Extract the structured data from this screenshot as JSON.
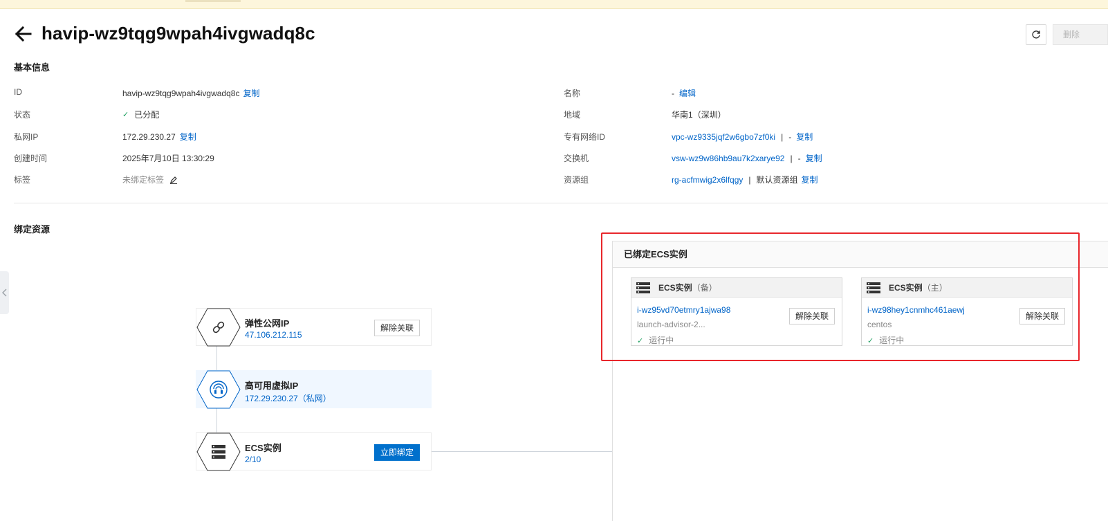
{
  "header": {
    "title": "havip-wz9tqg9wpah4ivgwadq8c",
    "delete_label": "删除"
  },
  "basic_info": {
    "section_title": "基本信息",
    "id_label": "ID",
    "id_value": "havip-wz9tqg9wpah4ivgwadq8c",
    "copy_label": "复制",
    "status_label": "状态",
    "status_value": "已分配",
    "private_ip_label": "私网IP",
    "private_ip_value": "172.29.230.27",
    "created_label": "创建时间",
    "created_value": "2025年7月10日 13:30:29",
    "tags_label": "标签",
    "tags_value": "未绑定标签",
    "name_label": "名称",
    "name_value": "-",
    "edit_label": "编辑",
    "region_label": "地域",
    "region_value": "华南1（深圳）",
    "vpc_label": "专有网络ID",
    "vpc_value": "vpc-wz9335jqf2w6gbo7zf0ki",
    "vswitch_label": "交换机",
    "vswitch_value": "vsw-wz9w86hb9au7k2xarye92",
    "dash": "-",
    "pipe": "|",
    "rg_label": "资源组",
    "rg_value": "rg-acfmwig2x6lfqgy",
    "rg_name": "默认资源组"
  },
  "bound": {
    "section_title": "绑定资源",
    "eip": {
      "title": "弹性公网IP",
      "value": "47.106.212.115",
      "button": "解除关联"
    },
    "havip": {
      "title": "高可用虚拟IP",
      "value": "172.29.230.27（私网）"
    },
    "ecs": {
      "title": "ECS实例",
      "value": "2/10",
      "button": "立即绑定"
    }
  },
  "panel": {
    "title": "已绑定ECS实例",
    "cards": [
      {
        "title": "ECS实例",
        "role": "（备）",
        "id": "i-wz95vd70etmry1ajwa98",
        "name": "launch-advisor-2...",
        "status": "运行中",
        "button": "解除关联"
      },
      {
        "title": "ECS实例",
        "role": "（主）",
        "id": "i-wz98hey1cnmhc461aewj",
        "name": "centos",
        "status": "运行中",
        "button": "解除关联"
      }
    ]
  },
  "icons": [
    "back-arrow-icon",
    "refresh-icon",
    "check-icon",
    "edit-pencil-icon",
    "link-icon",
    "havip-icon",
    "server-icon",
    "chevron-left-icon"
  ],
  "colors": {
    "link": "#0064c8",
    "primary": "#0070cc",
    "highlight": "#e8262b",
    "success": "#20a162"
  }
}
